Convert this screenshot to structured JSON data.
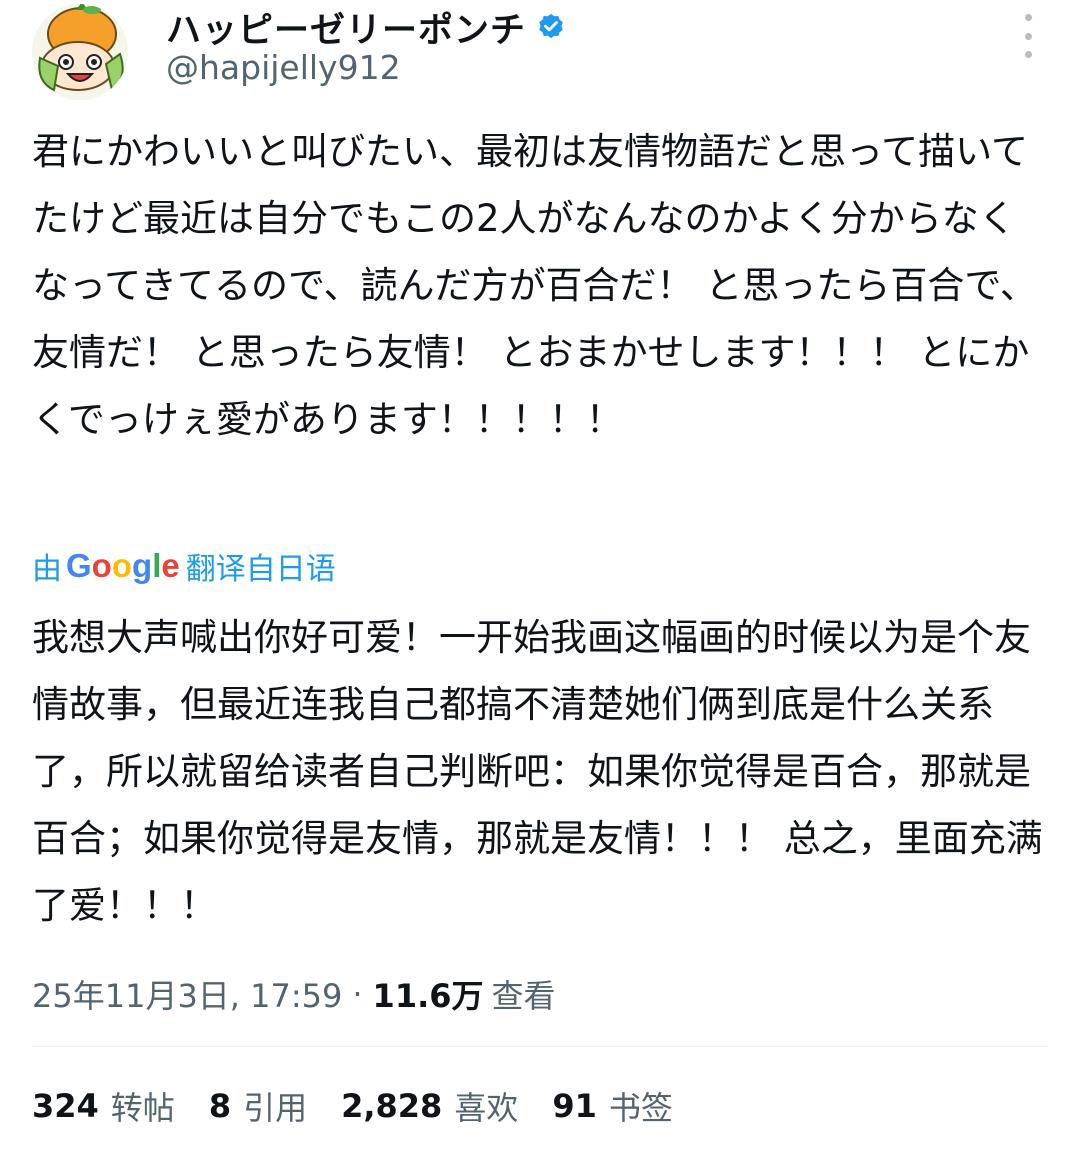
{
  "author": {
    "display_name": "ハッピーゼリーポンチ",
    "handle": "@hapijelly912",
    "verified": true,
    "avatar": "orange-hat-cartoon-avatar"
  },
  "tweet": {
    "text": "君にかわいいと叫びたい、最初は友情物語だと思って描いてたけど最近は自分でもこの2人がなんなのかよく分からなくなってきてるので、読んだ方が百合だ！ と思ったら百合で、友情だ！ と思ったら友情！ とおまかせします！！！ とにかくでっけぇ愛があります！！！！！",
    "translation_label": {
      "prefix": "由",
      "provider": "Google",
      "suffix": "翻译自日语"
    },
    "translated_text": "我想大声喊出你好可爱！一开始我画这幅画的时候以为是个友情故事，但最近连我自己都搞不清楚她们俩到底是什么关系了，所以就留给读者自己判断吧：如果你觉得是百合，那就是百合；如果你觉得是友情，那就是友情！！！ 总之，里面充满了爱！！！"
  },
  "meta": {
    "timestamp": "25年11月3日, 17:59",
    "separator": "·",
    "views_count": "11.6万",
    "views_label": "查看"
  },
  "stats": {
    "reposts": {
      "count": "324",
      "label": "转帖"
    },
    "quotes": {
      "count": "8",
      "label": "引用"
    },
    "likes": {
      "count": "2,828",
      "label": "喜欢"
    },
    "bookmarks": {
      "count": "91",
      "label": "书签"
    }
  },
  "colors": {
    "accent": "#1d9bf0",
    "text_primary": "#0f1419",
    "text_secondary": "#536471",
    "divider": "#eff3f4"
  }
}
